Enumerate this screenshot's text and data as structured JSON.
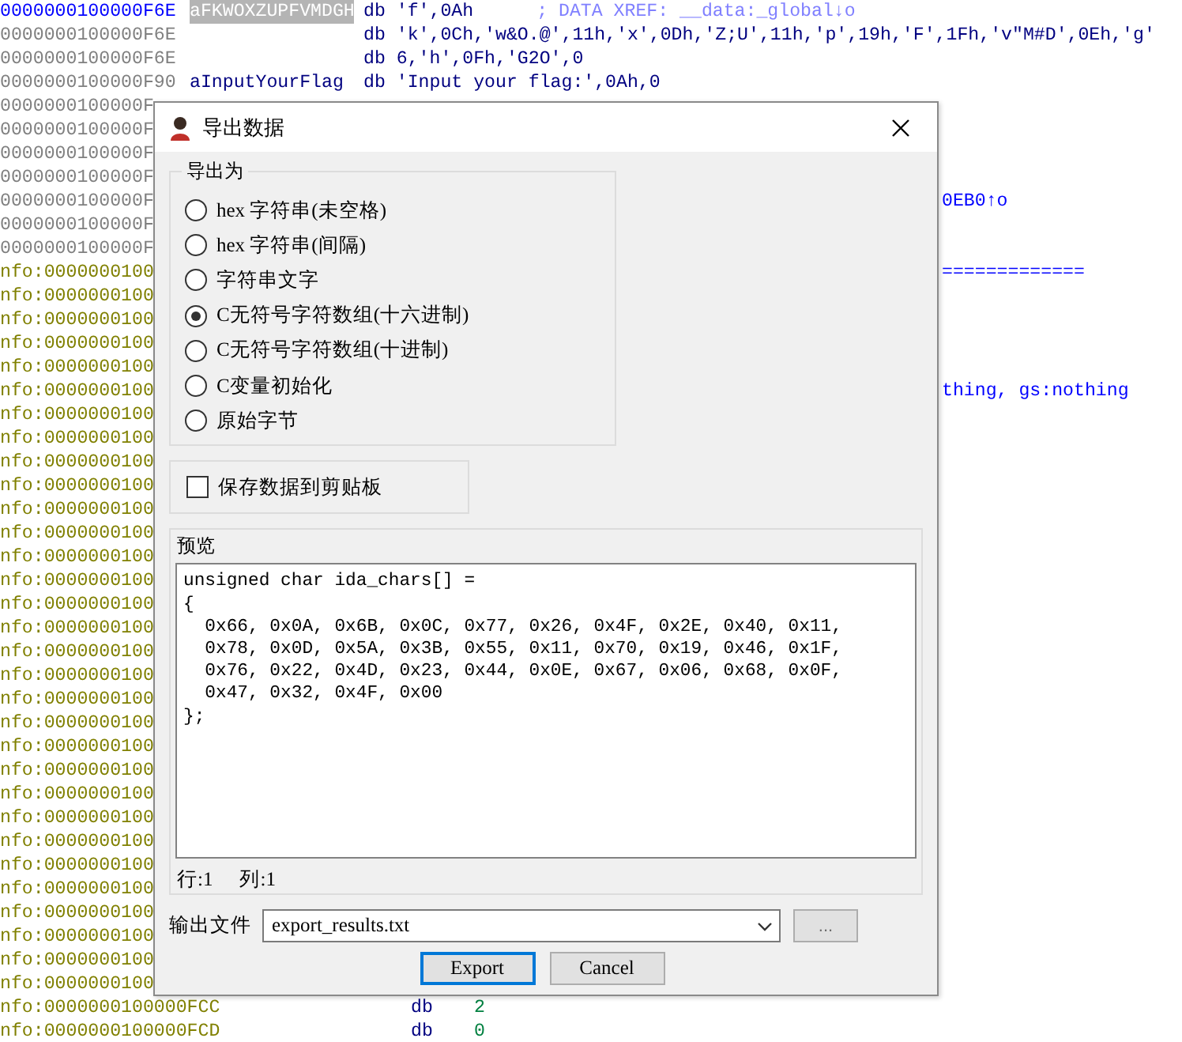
{
  "listing": [
    {
      "kind": "head",
      "address": "0000000100000F6E",
      "label": "aFKWOXZUPFVMDGH",
      "code": "db 'f',0Ah",
      "comment": "; DATA XREF: __data:_global↓o"
    },
    {
      "kind": "plain",
      "address": "0000000100000F6E",
      "code": "db 'k',0Ch,'w&O.@',11h,'x',0Dh,'Z;U',11h,'p',19h,'F',1Fh,'v\"M#D',0Eh,'g'"
    },
    {
      "kind": "plain",
      "address": "0000000100000F6E",
      "code": "db 6,'h',0Fh,'G2O',0"
    },
    {
      "kind": "named",
      "address": "0000000100000F90",
      "label": "aInputYourFlag",
      "code": "db 'Input your flag:',0Ah,0"
    },
    {
      "kind": "covered",
      "address": "0000000100000F"
    },
    {
      "kind": "covered",
      "address": "0000000100000F"
    },
    {
      "kind": "covered",
      "address": "0000000100000F"
    },
    {
      "kind": "covered",
      "address": "0000000100000F"
    },
    {
      "kind": "covered",
      "address": "0000000100000F",
      "tail": "0EB0↑o"
    },
    {
      "kind": "covered",
      "address": "0000000100000F"
    },
    {
      "kind": "covered",
      "address": "0000000100000F"
    },
    {
      "kind": "info",
      "address": "nfo:0000000100",
      "tail": "============="
    },
    {
      "kind": "info",
      "address": "nfo:0000000100"
    },
    {
      "kind": "info",
      "address": "nfo:0000000100"
    },
    {
      "kind": "info",
      "address": "nfo:0000000100"
    },
    {
      "kind": "info",
      "address": "nfo:0000000100"
    },
    {
      "kind": "info",
      "address": "nfo:0000000100",
      "tail": "thing, gs:nothing"
    },
    {
      "kind": "info",
      "address": "nfo:0000000100"
    },
    {
      "kind": "info",
      "address": "nfo:0000000100"
    },
    {
      "kind": "info",
      "address": "nfo:0000000100"
    },
    {
      "kind": "info",
      "address": "nfo:0000000100"
    },
    {
      "kind": "info",
      "address": "nfo:0000000100"
    },
    {
      "kind": "info",
      "address": "nfo:0000000100"
    },
    {
      "kind": "info",
      "address": "nfo:0000000100"
    },
    {
      "kind": "info",
      "address": "nfo:0000000100"
    },
    {
      "kind": "info",
      "address": "nfo:0000000100"
    },
    {
      "kind": "info",
      "address": "nfo:0000000100"
    },
    {
      "kind": "info",
      "address": "nfo:0000000100"
    },
    {
      "kind": "info",
      "address": "nfo:0000000100"
    },
    {
      "kind": "info",
      "address": "nfo:0000000100"
    },
    {
      "kind": "info",
      "address": "nfo:0000000100"
    },
    {
      "kind": "info",
      "address": "nfo:0000000100"
    },
    {
      "kind": "info",
      "address": "nfo:0000000100"
    },
    {
      "kind": "info",
      "address": "nfo:0000000100"
    },
    {
      "kind": "info",
      "address": "nfo:0000000100"
    },
    {
      "kind": "info",
      "address": "nfo:0000000100"
    },
    {
      "kind": "info",
      "address": "nfo:0000000100"
    },
    {
      "kind": "info",
      "address": "nfo:0000000100"
    },
    {
      "kind": "info",
      "address": "nfo:0000000100"
    },
    {
      "kind": "info",
      "address": "nfo:0000000100"
    },
    {
      "kind": "info",
      "address": "nfo:0000000100"
    },
    {
      "kind": "info",
      "address": "nfo:0000000100"
    },
    {
      "kind": "data",
      "address": "nfo:0000000100000FCC",
      "code": "db",
      "operand": "2"
    },
    {
      "kind": "data",
      "address": "nfo:0000000100000FCD",
      "code": "db",
      "operand": "0"
    }
  ],
  "dialog": {
    "title": "导出数据",
    "export_group": {
      "label": "导出为",
      "options": [
        {
          "label": "hex 字符串(未空格)",
          "selected": false
        },
        {
          "label": "hex 字符串(间隔)",
          "selected": false
        },
        {
          "label": "字符串文字",
          "selected": false
        },
        {
          "label": "C无符号字符数组(十六进制)",
          "selected": true
        },
        {
          "label": "C无符号字符数组(十进制)",
          "selected": false
        },
        {
          "label": "C变量初始化",
          "selected": false
        },
        {
          "label": "原始字节",
          "selected": false
        }
      ]
    },
    "clipboard": {
      "label": "保存数据到剪贴板",
      "checked": false
    },
    "preview": {
      "label": "预览",
      "lines": [
        "unsigned char ida_chars[] =",
        "{",
        "  0x66, 0x0A, 0x6B, 0x0C, 0x77, 0x26, 0x4F, 0x2E, 0x40, 0x11,",
        "  0x78, 0x0D, 0x5A, 0x3B, 0x55, 0x11, 0x70, 0x19, 0x46, 0x1F,",
        "  0x76, 0x22, 0x4D, 0x23, 0x44, 0x0E, 0x67, 0x06, 0x68, 0x0F,",
        "  0x47, 0x32, 0x4F, 0x00",
        "};"
      ]
    },
    "cursor": {
      "line": "行:1",
      "column": "列:1"
    },
    "output_file": {
      "label": "输出文件",
      "value": "export_results.txt",
      "browse": "..."
    },
    "buttons": [
      {
        "label": "Export",
        "default": true
      },
      {
        "label": "Cancel",
        "default": false
      }
    ]
  }
}
